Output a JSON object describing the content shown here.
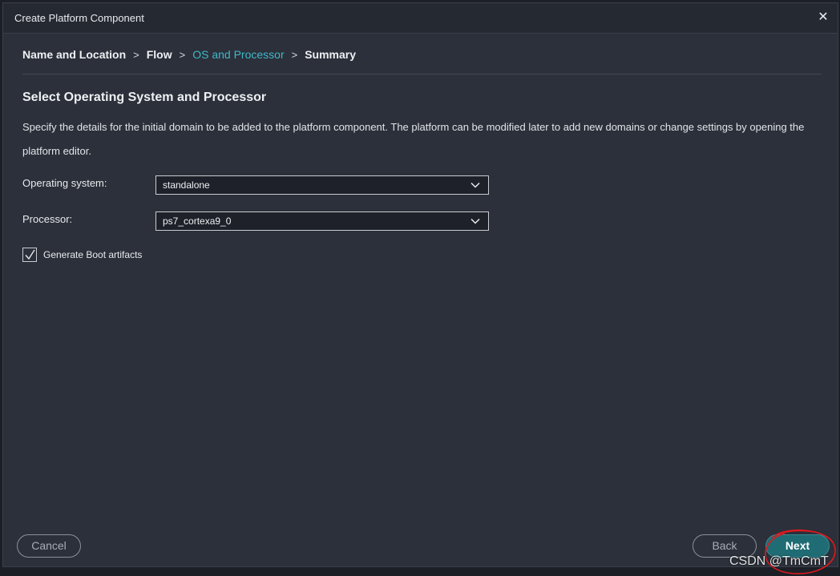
{
  "dialog": {
    "title": "Create Platform Component",
    "close_glyph": "✕"
  },
  "breadcrumb": {
    "steps": [
      "Name and Location",
      "Flow",
      "OS and Processor",
      "Summary"
    ],
    "active_index": 2,
    "separator": ">"
  },
  "section": {
    "title": "Select Operating System and Processor",
    "description": "Specify the details for the initial domain to be added to the platform component. The platform can be modified later to add new domains or change settings by opening the platform editor."
  },
  "form": {
    "os_label": "Operating system:",
    "os_value": "standalone",
    "processor_label": "Processor:",
    "processor_value": "ps7_cortexa9_0",
    "boot_label": "Generate Boot artifacts",
    "boot_checked": true
  },
  "footer": {
    "cancel_label": "Cancel",
    "back_label": "Back",
    "next_label": "Next"
  },
  "watermark": "CSDN @TmCmT",
  "colors": {
    "accent": "#3fb8c8",
    "primary_button": "#1f6c74",
    "annotation": "#e0191e"
  },
  "icons": {
    "close": "close-icon",
    "dropdown": "chevron-down-icon",
    "check": "check-icon"
  }
}
